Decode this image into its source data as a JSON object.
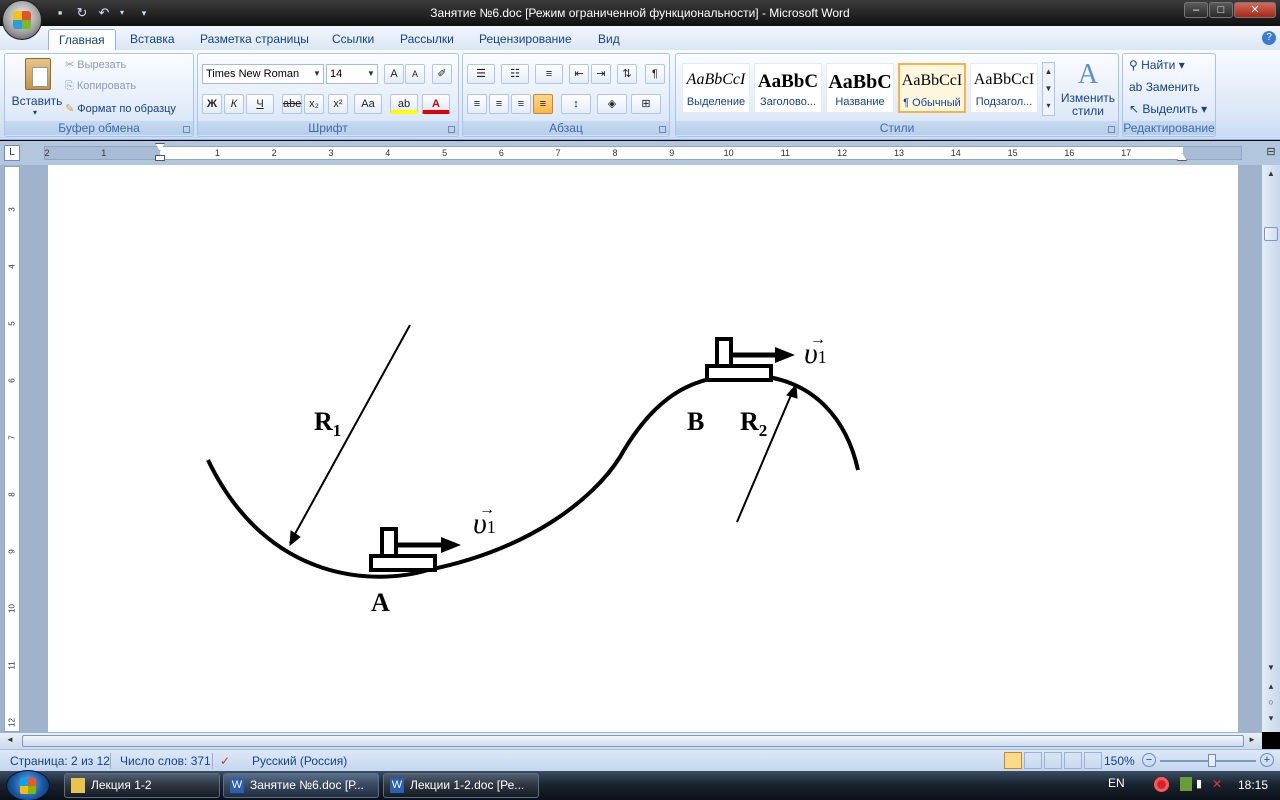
{
  "window": {
    "title": "Занятие №6.doc [Режим ограниченной функциональности] - Microsoft Word",
    "min": "–",
    "max": "□",
    "close": "✕"
  },
  "tabs": [
    "Главная",
    "Вставка",
    "Разметка страницы",
    "Ссылки",
    "Рассылки",
    "Рецензирование",
    "Вид"
  ],
  "clipboard": {
    "paste": "Вставить",
    "cut": "Вырезать",
    "copy": "Копировать",
    "format_painter": "Формат по образцу",
    "label": "Буфер обмена"
  },
  "font": {
    "name": "Times New Roman",
    "size": "14",
    "label": "Шрифт",
    "bold": "Ж",
    "italic": "К",
    "underline": "Ч",
    "strike": "abe",
    "sub": "x₂",
    "sup": "x²",
    "case": "Aa",
    "grow": "A",
    "shrink": "A"
  },
  "paragraph": {
    "label": "Абзац",
    "pilcrow": "¶"
  },
  "styles": {
    "label": "Стили",
    "items": [
      {
        "sample": "AaBbCcI",
        "name": "Выделение"
      },
      {
        "sample": "AaBbC",
        "name": "Заголово..."
      },
      {
        "sample": "AaBbC",
        "name": "Название"
      },
      {
        "sample": "AaBbCcI",
        "name": "¶ Обычный"
      },
      {
        "sample": "AaBbCcI",
        "name": "Подзагол..."
      }
    ],
    "change_l1": "Изменить",
    "change_l2": "стили"
  },
  "editing": {
    "find": "Найти",
    "replace": "Заменить",
    "select": "Выделить",
    "label": "Редактирование"
  },
  "ruler": {
    "numbers": [
      "2",
      "1",
      "",
      "1",
      "2",
      "3",
      "4",
      "5",
      "6",
      "7",
      "8",
      "9",
      "10",
      "11",
      "12",
      "13",
      "14",
      "15",
      "16",
      "17"
    ],
    "vnumbers": [
      "3",
      "4",
      "5",
      "6",
      "7",
      "8",
      "9",
      "10",
      "11",
      "12"
    ]
  },
  "figure": {
    "label_r1": "R",
    "sub_r1": "1",
    "label_r2": "R",
    "sub_r2": "2",
    "label_a": "A",
    "label_b": "B",
    "v_symbol": "υ",
    "v_sub": "1",
    "v_arrow": "→"
  },
  "status": {
    "page": "Страница: 2 из 12",
    "words": "Число слов: 371",
    "language": "Русский (Россия)",
    "zoom": "150%"
  },
  "taskbar": {
    "tasks": [
      {
        "label": "Лекция 1-2",
        "active": false
      },
      {
        "label": "Занятие №6.doc [Р...",
        "active": true
      },
      {
        "label": "Лекции 1-2.doc [Ре...",
        "active": false
      }
    ],
    "lang": "EN",
    "time": "18:15"
  }
}
